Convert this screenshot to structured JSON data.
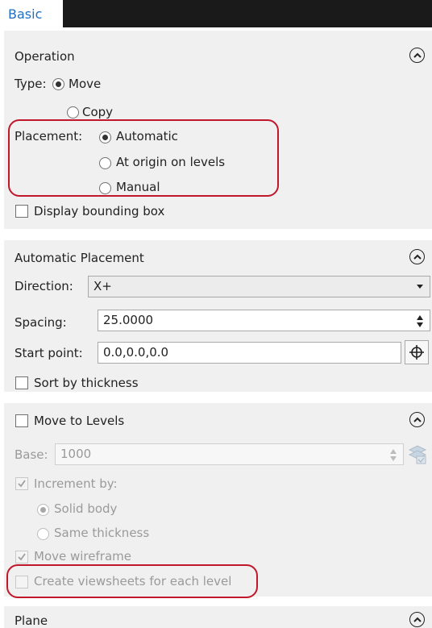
{
  "tabs": [
    {
      "label": "Basic"
    }
  ],
  "operation": {
    "title": "Operation",
    "type_label": "Type:",
    "type_options": [
      "Move",
      "Copy"
    ],
    "type_selected": "Move",
    "placement_label": "Placement:",
    "placement_options": [
      "Automatic",
      "At origin on levels",
      "Manual"
    ],
    "placement_selected": "Automatic",
    "display_bbox_label": "Display bounding box",
    "display_bbox_checked": false
  },
  "automatic_placement": {
    "title": "Automatic Placement",
    "direction_label": "Direction:",
    "direction_value": "X+",
    "spacing_label": "Spacing:",
    "spacing_value": "25.0000",
    "start_point_label": "Start point:",
    "start_point_value": "0.0,0.0,0.0",
    "sort_label": "Sort by thickness",
    "sort_checked": false
  },
  "move_to_levels": {
    "title": "Move to Levels",
    "checked": false,
    "base_label": "Base:",
    "base_value": "1000",
    "increment_label": "Increment by:",
    "increment_checked": true,
    "increment_options": [
      "Solid body",
      "Same thickness"
    ],
    "increment_selected": "Solid body",
    "move_wireframe_label": "Move wireframe",
    "move_wireframe_checked": true,
    "create_viewsheets_label": "Create viewsheets for each level",
    "create_viewsheets_checked": false
  },
  "plane": {
    "title": "Plane"
  },
  "icons": {
    "collapse": "chevron-up-circle-icon",
    "pick_point": "crosshair-icon",
    "level_manager": "layers-icon"
  },
  "colors": {
    "tab_text": "#1e6fc3",
    "highlight": "#c0182a",
    "panel_bg": "#f0f0f0",
    "tabbar_bg": "#1a1a1a"
  }
}
